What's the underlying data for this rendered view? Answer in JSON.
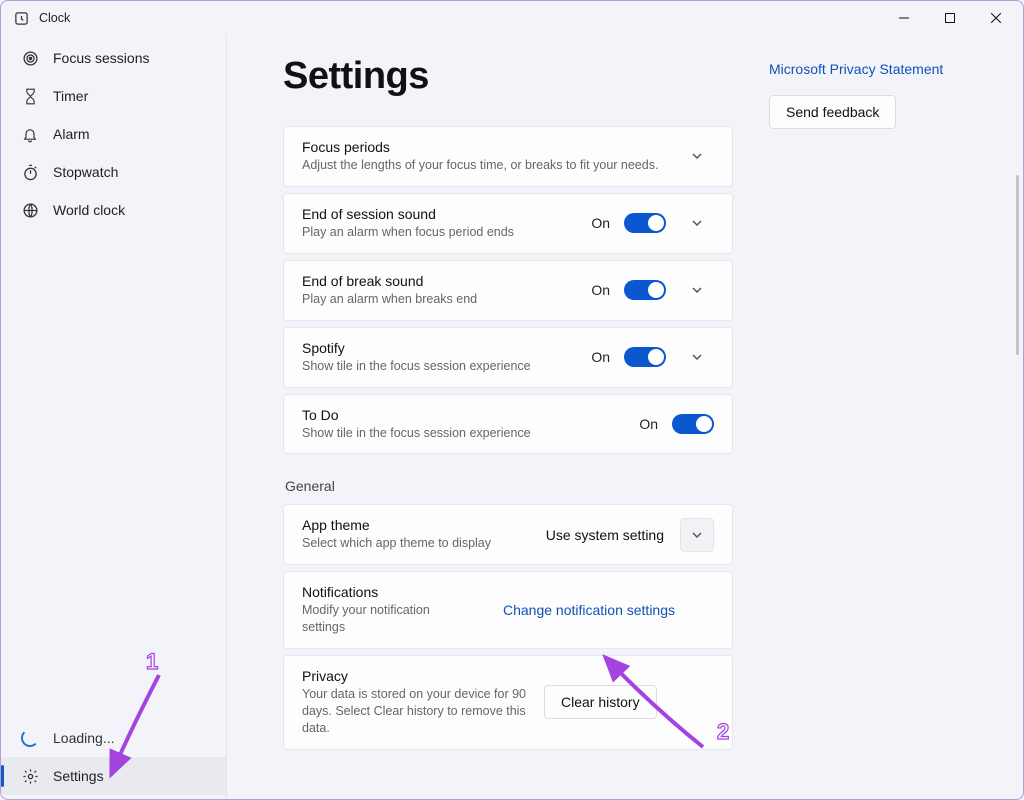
{
  "app": {
    "title": "Clock"
  },
  "window_controls": {
    "min": "minimize",
    "max": "maximize",
    "close": "close"
  },
  "sidebar": {
    "items": [
      {
        "label": "Focus sessions",
        "icon": "target-icon"
      },
      {
        "label": "Timer",
        "icon": "hourglass-icon"
      },
      {
        "label": "Alarm",
        "icon": "bell-icon"
      },
      {
        "label": "Stopwatch",
        "icon": "stopwatch-icon"
      },
      {
        "label": "World clock",
        "icon": "globe-icon"
      }
    ],
    "loading_label": "Loading...",
    "settings_label": "Settings"
  },
  "page": {
    "title": "Settings"
  },
  "focus_settings": [
    {
      "title": "Focus periods",
      "desc": "Adjust the lengths of your focus time, or breaks to fit your needs.",
      "has_toggle": false,
      "expandable": true
    },
    {
      "title": "End of session sound",
      "desc": "Play an alarm when focus period ends",
      "has_toggle": true,
      "state": "On",
      "expandable": true
    },
    {
      "title": "End of break sound",
      "desc": "Play an alarm when breaks end",
      "has_toggle": true,
      "state": "On",
      "expandable": true
    },
    {
      "title": "Spotify",
      "desc": "Show tile in the focus session experience",
      "has_toggle": true,
      "state": "On",
      "expandable": true
    },
    {
      "title": "To Do",
      "desc": "Show tile in the focus session experience",
      "has_toggle": true,
      "state": "On",
      "expandable": false
    }
  ],
  "general_label": "General",
  "general": {
    "theme": {
      "title": "App theme",
      "desc": "Select which app theme to display",
      "value": "Use system setting"
    },
    "notifications": {
      "title": "Notifications",
      "desc": "Modify your notification settings",
      "link": "Change notification settings"
    },
    "privacy": {
      "title": "Privacy",
      "desc": "Your data is stored on your device for 90 days. Select Clear history to remove this data.",
      "button": "Clear history"
    }
  },
  "aside": {
    "privacy_link": "Microsoft Privacy Statement",
    "feedback_button": "Send feedback"
  },
  "annotations": {
    "one": "1",
    "two": "2"
  }
}
